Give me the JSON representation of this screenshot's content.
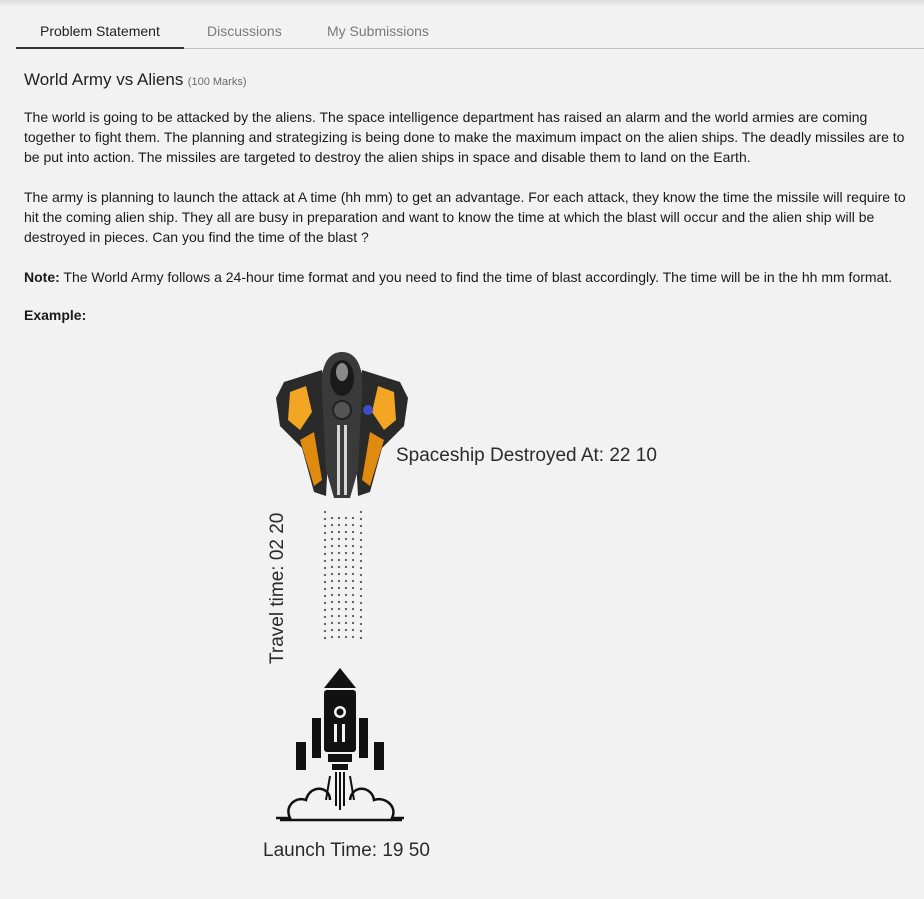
{
  "tabs": [
    {
      "label": "Problem Statement",
      "active": true
    },
    {
      "label": "Discussions",
      "active": false
    },
    {
      "label": "My Submissions",
      "active": false
    }
  ],
  "problem": {
    "title": "World Army vs Aliens",
    "marks": "(100 Marks)",
    "para1": "The world is going to be attacked by the aliens. The space intelligence department has raised an alarm and the world armies are coming together to fight them. The planning and strategizing is being done to make the maximum impact on the alien ships. The deadly missiles are to be put into action. The missiles are targeted to destroy the alien ships in space and disable them to land on the Earth.",
    "para2": "The army is planning to launch the attack at A time (hh mm) to get an advantage. For each attack, they know the time the missile will require to hit the coming alien ship. They all are busy in preparation and want to know the time at which the blast will occur and the alien ship will be destroyed in pieces. Can you find the time of the blast ?",
    "note_label": "Note:",
    "note_text": " The World Army follows a 24-hour time format and you need to find the time of blast accordingly. The time will be in the hh mm format.",
    "example_label": "Example:"
  },
  "figure": {
    "destroyed_text": "Spaceship Destroyed At: 22 10",
    "travel_text": "Travel time: 02 20",
    "launch_text": "Launch Time: 19 50",
    "icons": [
      "alien-spaceship-icon",
      "rocket-launch-icon"
    ]
  },
  "colors": {
    "background": "#f2f2f2",
    "tab_active_underline": "#333333",
    "tab_inactive_text": "#7a7a7a",
    "spaceship_accent": "#f2a623"
  }
}
